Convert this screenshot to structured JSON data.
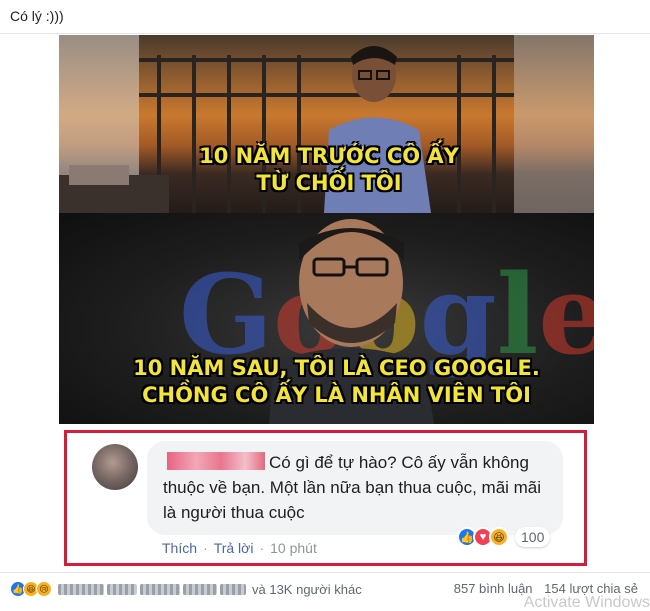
{
  "post": {
    "caption": "Có lý :)))"
  },
  "meme": {
    "top_caption": "10 NĂM TRƯỚC CÔ ẤY TỪ CHỐI TÔI",
    "bottom_caption": "10 NĂM SAU, TÔI LÀ CEO GOOGLE. CHỒNG CÔ ẤY LÀ NHÂN VIÊN TÔI",
    "background_logo": "Google"
  },
  "comment": {
    "text": "Có gì để tự hào? Cô ấy vẫn không thuộc về bạn. Một lần nữa bạn thua cuộc, mãi mãi là người thua cuộc",
    "actions": {
      "like": "Thích",
      "reply": "Trả lời",
      "time": "10 phút"
    },
    "reaction_icons": [
      "like-icon",
      "love-icon",
      "haha-icon"
    ],
    "reaction_count": "100",
    "highlight_color": "#d31d3a"
  },
  "footer": {
    "reaction_icons": [
      "like-icon",
      "haha-icon",
      "sad-icon"
    ],
    "others": "và 13K người khác",
    "comments": "857 bình luận",
    "shares": "154 lượt chia sẻ"
  },
  "watermark": "Activate Windows",
  "colors": {
    "like": "#1877f2",
    "love": "#f33e58",
    "haha": "#f7b125",
    "meme_text": "#f2e43a"
  }
}
